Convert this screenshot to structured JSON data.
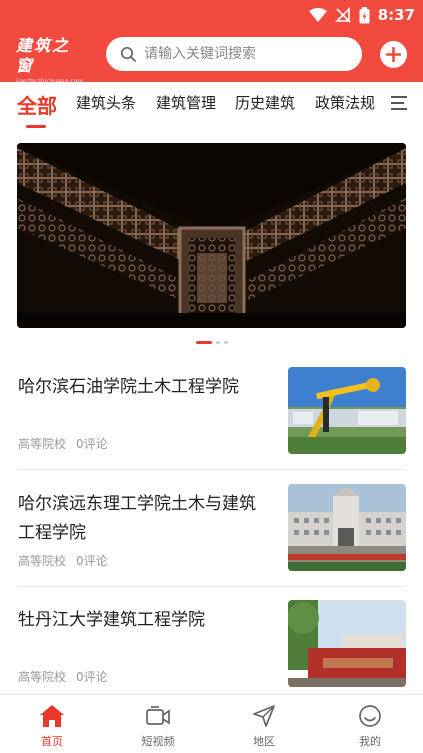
{
  "status_bar": {
    "time": "8:37"
  },
  "header": {
    "logo_text": "建筑之窗",
    "logo_subtext": "jianzhuzhichuang.com",
    "search_placeholder": "请输入关键词搜索",
    "add_icon": "plus-circle-icon",
    "accent_color": "#f24a3e"
  },
  "tabs": [
    {
      "label": "全部",
      "active": true
    },
    {
      "label": "建筑头条"
    },
    {
      "label": "建筑管理"
    },
    {
      "label": "历史建筑"
    },
    {
      "label": "政策法规"
    }
  ],
  "banner": {
    "slide_count": 3,
    "active_slide": 1
  },
  "news": [
    {
      "title": "哈尔滨石油学院土木工程学院",
      "category": "高等院校",
      "comments": "0评论"
    },
    {
      "title": "哈尔滨远东理工学院土木与建筑工程学院",
      "category": "高等院校",
      "comments": "0评论"
    },
    {
      "title": "牡丹江大学建筑工程学院",
      "category": "高等院校",
      "comments": "0评论"
    }
  ],
  "bottom_nav": [
    {
      "label": "首页",
      "icon": "home-icon",
      "active": true
    },
    {
      "label": "短视频",
      "icon": "video-icon"
    },
    {
      "label": "地区",
      "icon": "location-arrow-icon"
    },
    {
      "label": "我的",
      "icon": "smile-profile-icon"
    }
  ]
}
